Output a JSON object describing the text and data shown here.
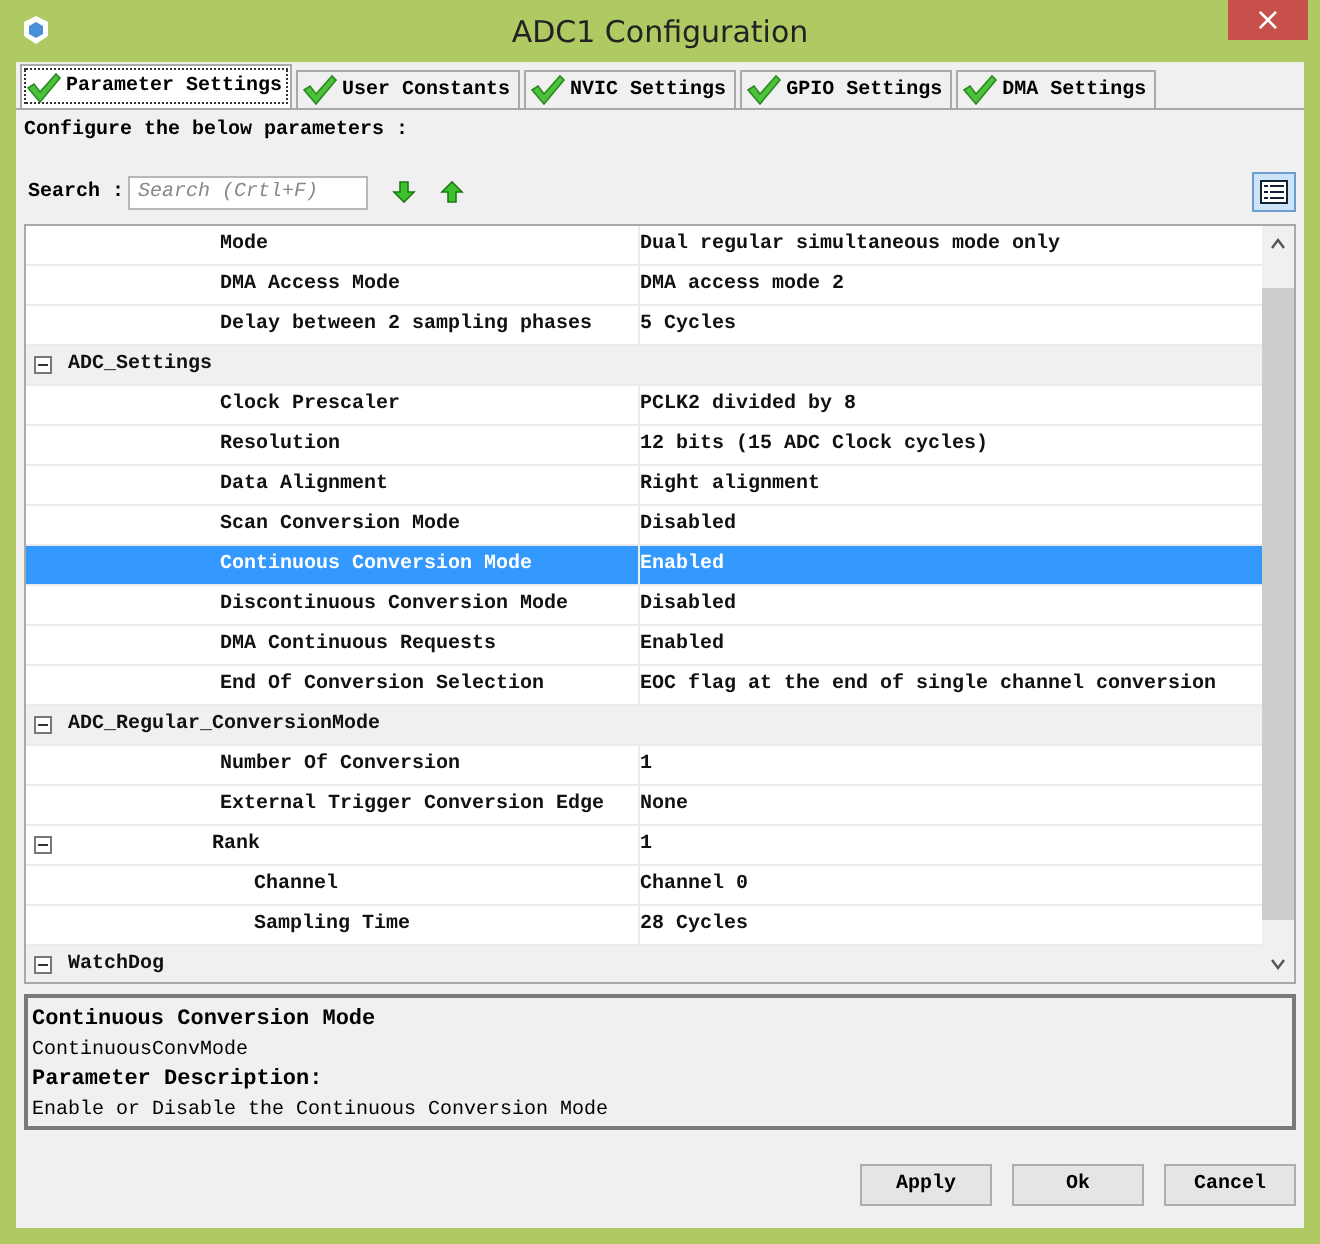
{
  "window": {
    "title": "ADC1 Configuration",
    "close": "×"
  },
  "tabs": [
    {
      "label": "Parameter Settings",
      "selected": true
    },
    {
      "label": "User Constants",
      "selected": false
    },
    {
      "label": "NVIC Settings",
      "selected": false
    },
    {
      "label": "GPIO Settings",
      "selected": false
    },
    {
      "label": "DMA Settings",
      "selected": false
    }
  ],
  "instructions": "Configure the below parameters :",
  "search": {
    "label": "Search :",
    "placeholder": "Search (Crtl+F)"
  },
  "table": {
    "rows": [
      {
        "children": [
          {
            "label": "Mode",
            "value": "Dual regular simultaneous mode only",
            "selected": false
          },
          {
            "label": "DMA Access Mode",
            "value": "DMA access mode 2",
            "selected": false
          },
          {
            "label": "Delay between 2 sampling phases",
            "value": "5 Cycles",
            "selected": false
          }
        ]
      },
      {
        "label": "ADC_Settings",
        "expanded": true,
        "children": [
          {
            "label": "Clock Prescaler",
            "value": "PCLK2 divided by 8",
            "selected": false
          },
          {
            "label": "Resolution",
            "value": "12 bits (15 ADC Clock cycles)",
            "selected": false
          },
          {
            "label": "Data Alignment",
            "value": "Right alignment",
            "selected": false
          },
          {
            "label": "Scan Conversion Mode",
            "value": "Disabled",
            "selected": false
          },
          {
            "label": "Continuous Conversion Mode",
            "value": "Enabled",
            "selected": true
          },
          {
            "label": "Discontinuous Conversion Mode",
            "value": "Disabled",
            "selected": false
          },
          {
            "label": "DMA Continuous Requests",
            "value": "Enabled",
            "selected": false
          },
          {
            "label": "End Of Conversion Selection",
            "value": "EOC flag at the end of single channel conversion",
            "selected": false
          }
        ]
      },
      {
        "label": "ADC_Regular_ConversionMode",
        "expanded": true,
        "children": [
          {
            "label": "Number Of Conversion",
            "value": "1",
            "selected": false
          },
          {
            "label": "External Trigger Conversion Edge",
            "value": "None",
            "selected": false
          },
          {
            "label": "Rank",
            "value": "1",
            "expanded": true,
            "selected": false,
            "children": [
              {
                "label": "Channel",
                "value": "Channel 0",
                "selected": false
              },
              {
                "label": "Sampling Time",
                "value": "28 Cycles",
                "selected": false
              }
            ]
          }
        ]
      },
      {
        "label": "WatchDog",
        "expanded": true
      }
    ]
  },
  "description": {
    "title": "Continuous Conversion Mode",
    "name": "ContinuousConvMode",
    "heading": "Parameter Description:",
    "text": "Enable or Disable the Continuous Conversion Mode"
  },
  "buttons": [
    "Apply",
    "Ok",
    "Cancel"
  ]
}
